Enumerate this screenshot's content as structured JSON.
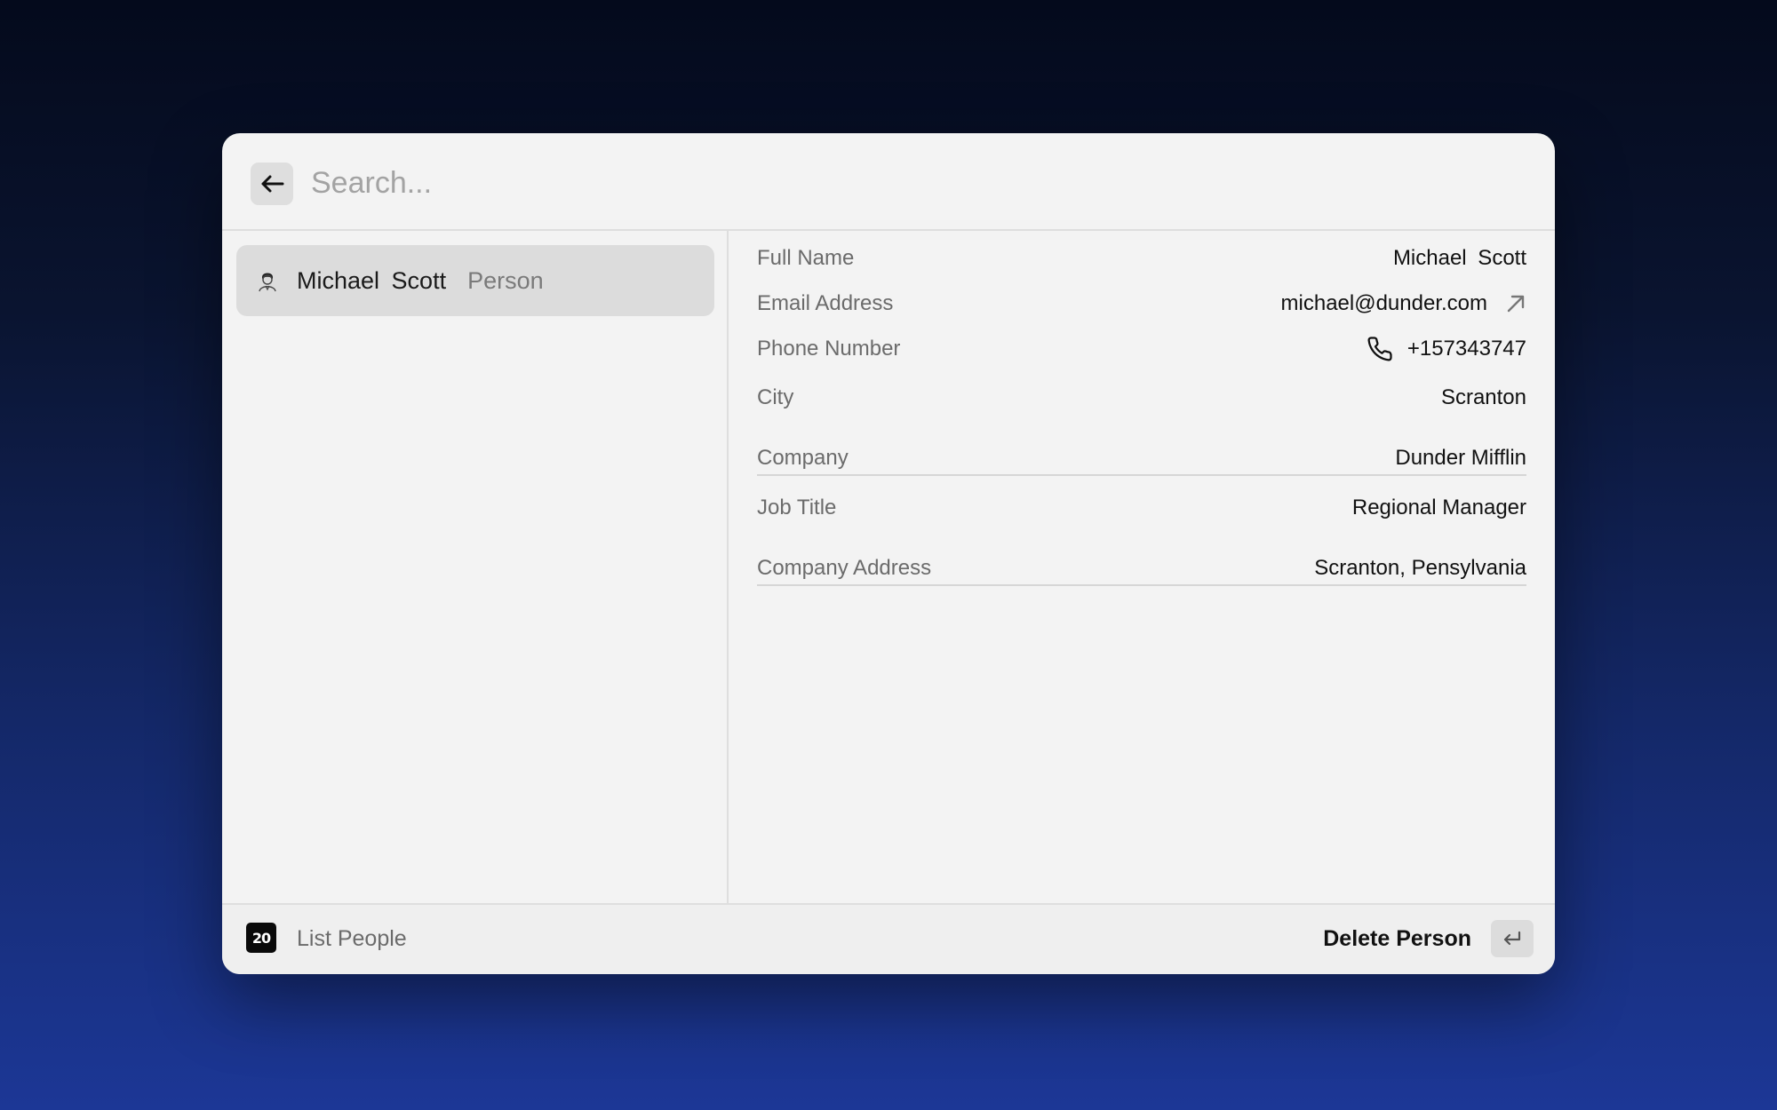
{
  "search": {
    "placeholder": "Search..."
  },
  "list": {
    "items": [
      {
        "title": "Michael  Scott",
        "subtitle": "Person",
        "icon": "person-avatar-icon"
      }
    ]
  },
  "detail": {
    "fields": [
      {
        "label": "Full Name",
        "value": "Michael  Scott"
      },
      {
        "label": "Email Address",
        "value": "michael@dunder.com",
        "icon": "arrow-up-right-icon"
      },
      {
        "label": "Phone Number",
        "value": "+157343747",
        "icon": "phone-icon"
      },
      {
        "label": "City",
        "value": "Scranton"
      },
      {
        "label": "Company",
        "value": "Dunder Mifflin"
      },
      {
        "label": "Job Title",
        "value": "Regional Manager"
      },
      {
        "label": "Company Address",
        "value": "Scranton, Pensylvania"
      }
    ]
  },
  "footer": {
    "logo_text": "20",
    "title": "List People",
    "action_label": "Delete Person",
    "action_key_icon": "enter-key-icon"
  },
  "icons": {
    "back": "arrow-left-icon"
  },
  "colors": {
    "window_bg": "#f3f3f3",
    "selected_item_bg": "#dcdcdc",
    "label_gray": "#6b6b6b",
    "background_top": "#040a1c",
    "background_bottom": "#1c3796"
  }
}
